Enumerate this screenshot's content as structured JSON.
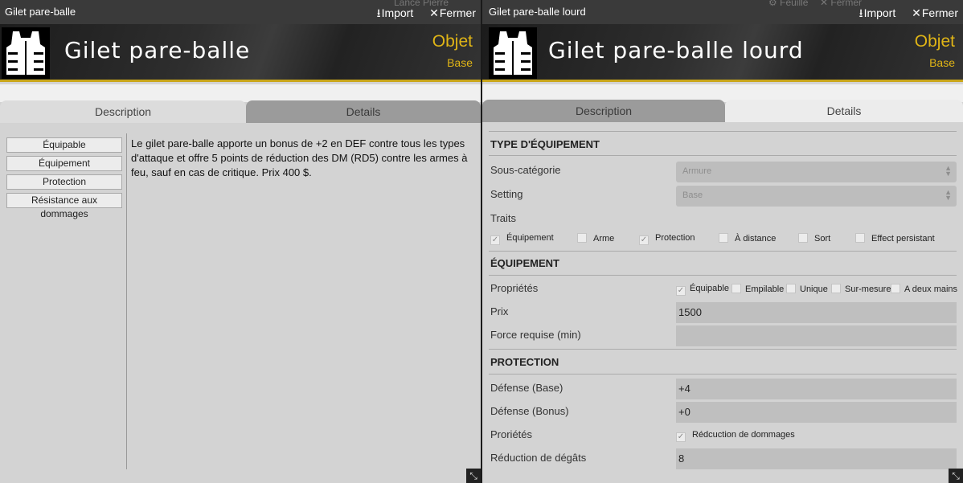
{
  "left_window": {
    "title": "Gilet pare-balle",
    "ghost_text": "Lance Pierre",
    "import_label": "Import",
    "close_label": "Fermer",
    "item_name": "Gilet pare-balle",
    "item_kind": "Objet",
    "item_sub": "Base",
    "tab_description": "Description",
    "tab_details": "Details",
    "tags": [
      "Équipable",
      "Équipement",
      "Protection",
      "Résistance aux dommages"
    ],
    "description": "Le gilet pare-balle apporte un bonus de +2 en DEF contre tous les types d'attaque et offre 5 points de réduction des DM (RD5) contre les armes à feu, sauf en cas de critique. Prix 400 $."
  },
  "right_window": {
    "title": "Gilet pare-balle lourd",
    "ghost_sheet": "Feuille",
    "ghost_close": "Fermer",
    "import_label": "Import",
    "close_label": "Fermer",
    "item_name": "Gilet pare-balle lourd",
    "item_kind": "Objet",
    "item_sub": "Base",
    "tab_description": "Description",
    "tab_details": "Details",
    "section_type": "TYPE D'ÉQUIPEMENT",
    "subcategory_label": "Sous-catégorie",
    "subcategory_value": "Armure",
    "setting_label": "Setting",
    "setting_value": "Base",
    "traits_label": "Traits",
    "traits": [
      {
        "label": "Équipement",
        "checked": true
      },
      {
        "label": "Arme",
        "checked": false
      },
      {
        "label": "Protection",
        "checked": true
      },
      {
        "label": "À distance",
        "checked": false
      },
      {
        "label": "Sort",
        "checked": false
      },
      {
        "label": "Effect persistant",
        "checked": false
      }
    ],
    "section_equip": "ÉQUIPEMENT",
    "properties_label": "Propriétés",
    "properties": [
      {
        "label": "Équipable",
        "checked": true
      },
      {
        "label": "Empilable",
        "checked": false
      },
      {
        "label": "Unique",
        "checked": false
      },
      {
        "label": "Sur-mesure",
        "checked": false
      },
      {
        "label": "A deux mains",
        "checked": false
      }
    ],
    "price_label": "Prix",
    "price_value": "1500",
    "strength_label": "Force requise (min)",
    "strength_value": "",
    "section_protection": "PROTECTION",
    "def_base_label": "Défense (Base)",
    "def_base_value": "+4",
    "def_bonus_label": "Défense (Bonus)",
    "def_bonus_value": "+0",
    "prop2_label": "Proriétés",
    "prop2_option": "Rédcuction de dommages",
    "prop2_checked": true,
    "dmg_red_label": "Réduction de dégâts",
    "dmg_red_value": "8"
  },
  "icons": {
    "download": "download-icon",
    "close": "close-icon",
    "vest": "vest-icon",
    "resize": "resize-icon",
    "gear": "gear-icon"
  },
  "colors": {
    "accent": "#e0b516",
    "titlebar": "#3a3a3a"
  }
}
